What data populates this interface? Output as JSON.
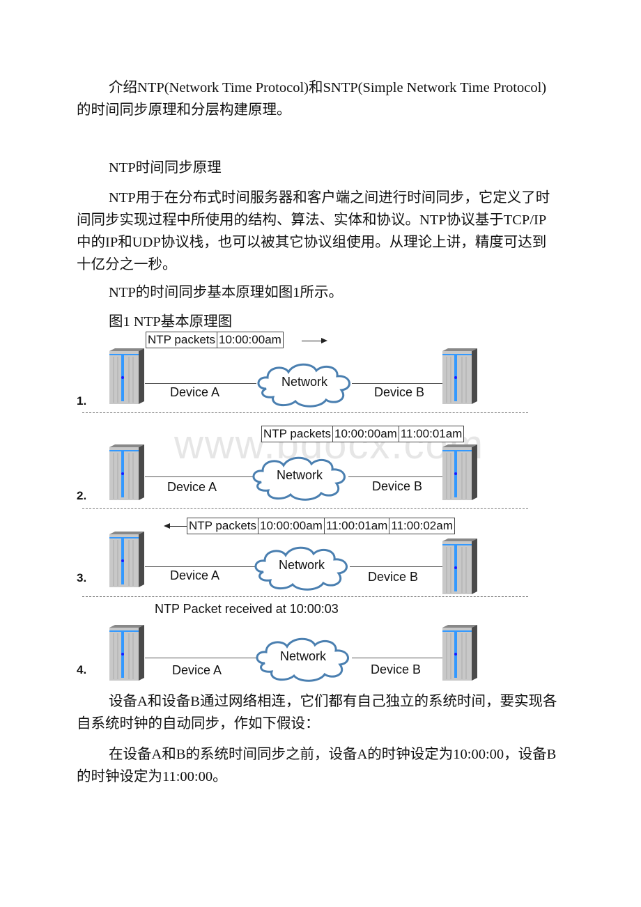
{
  "intro": {
    "text": "介绍NTP(Network Time Protocol)和SNTP(Simple Network Time Protocol)的时间同步原理和分层构建原理。"
  },
  "section": {
    "heading": "NTP时间同步原理",
    "para1": "NTP用于在分布式时间服务器和客户端之间进行时间同步，它定义了时间同步实现过程中所使用的结构、算法、实体和协议。NTP协议基于TCP/IP中的IP和UDP协议栈，也可以被其它协议组使用。从理论上讲，精度可达到十亿分之一秒。",
    "para2": "NTP的时间同步基本原理如图1所示。",
    "figure_caption": "图1 NTP基本原理图"
  },
  "figure": {
    "network_label": "Network",
    "device_a": "Device A",
    "device_b": "Device B",
    "watermark": "www.bdocx.com",
    "steps": [
      {
        "number": "1.",
        "packet": [
          "NTP packets",
          "10:00:00am"
        ],
        "direction": "right"
      },
      {
        "number": "2.",
        "packet": [
          "NTP packets",
          "10:00:00am",
          "11:00:01am"
        ],
        "direction": "none"
      },
      {
        "number": "3.",
        "packet": [
          "NTP packets",
          "10:00:00am",
          "11:00:01am",
          "11:00:02am"
        ],
        "direction": "left"
      },
      {
        "number": "4.",
        "received_text": "NTP Packet received at 10:00:03"
      }
    ]
  },
  "after": {
    "para1": "设备A和设备B通过网络相连，它们都有自己独立的系统时间，要实现各自系统时钟的自动同步，作如下假设：",
    "para2": "在设备A和B的系统时间同步之前，设备A的时钟设定为10:00:00，设备B的时钟设定为11:00:00。"
  },
  "colors": {
    "server_body": "#c8c8c8",
    "server_accent": "#3399ff",
    "server_side": "#4a4a4a",
    "cloud_stroke": "#4a7fb0"
  }
}
